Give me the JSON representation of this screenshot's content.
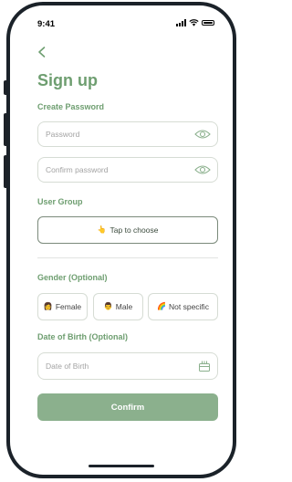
{
  "status_bar": {
    "time": "9:41"
  },
  "page": {
    "title": "Sign up"
  },
  "password_section": {
    "label": "Create Password",
    "password_placeholder": "Password",
    "confirm_placeholder": "Confirm password",
    "icon": "eye-icon"
  },
  "user_group": {
    "label": "User Group",
    "button_label": "Tap to choose",
    "button_icon": "pointing-hand-icon"
  },
  "gender": {
    "label": "Gender (Optional)",
    "options": [
      {
        "label": "Female",
        "icon": "woman-icon"
      },
      {
        "label": "Male",
        "icon": "man-icon"
      },
      {
        "label": "Not specific",
        "icon": "rainbow-icon"
      }
    ]
  },
  "dob": {
    "label": "Date of Birth  (Optional)",
    "placeholder": "Date of Birth",
    "icon": "calendar-icon"
  },
  "actions": {
    "confirm_label": "Confirm"
  },
  "colors": {
    "accent": "#6e9e70",
    "button": "#8bb08d",
    "frame": "#1b2229"
  }
}
